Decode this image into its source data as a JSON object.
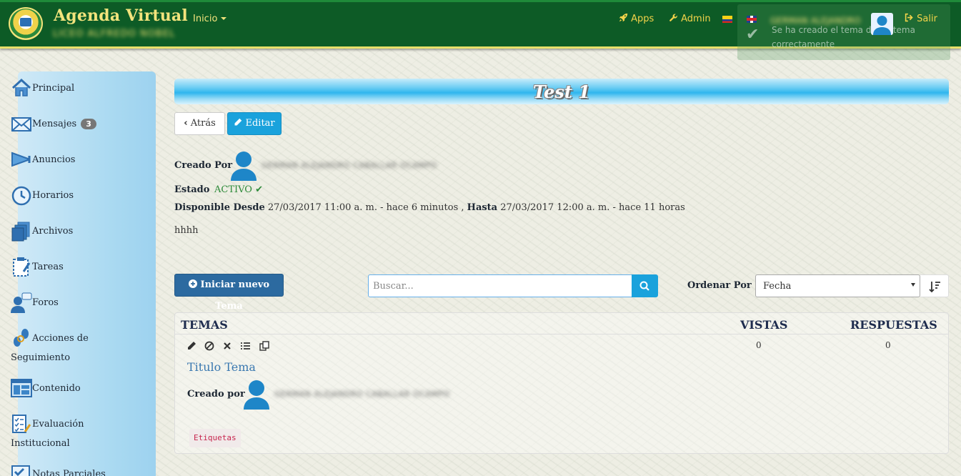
{
  "header": {
    "brand": "Agenda Virtual",
    "school": "LICEO ALFREDO NOBEL",
    "nav_inicio": "Inicio",
    "apps": "Apps",
    "admin": "Admin",
    "user_name": "GERMAN ALEJANDRO",
    "salir": "Salir"
  },
  "toast": {
    "message": "Se ha creado el tema del sistema correctamente"
  },
  "sidebar": {
    "items": [
      {
        "label": "Principal",
        "icon": "home-icon"
      },
      {
        "label": "Mensajes",
        "icon": "envelope-icon",
        "badge": "3"
      },
      {
        "label": "Anuncios",
        "icon": "megaphone-icon"
      },
      {
        "label": "Horarios",
        "icon": "clock-icon"
      },
      {
        "label": "Archivos",
        "icon": "files-icon"
      },
      {
        "label": "Tareas",
        "icon": "clipboard-icon"
      },
      {
        "label": "Foros",
        "icon": "forum-icon"
      },
      {
        "label": "Acciones de",
        "label2": "Seguimiento",
        "icon": "footsteps-icon"
      },
      {
        "label": "Contenido",
        "icon": "content-icon"
      },
      {
        "label": "Evaluación",
        "label2": "Institucional",
        "icon": "checklist-icon"
      },
      {
        "label": "Notas Parciales",
        "icon": "grades-icon"
      }
    ]
  },
  "page": {
    "title": "Test 1",
    "back": "Atrás",
    "edit": "Editar",
    "created_by_label": "Creado Por",
    "creator_name": "GERMAN ALEJANDRO CABALLAR OCAMPO",
    "estado_label": "Estado",
    "estado_value": "ACTIVO",
    "disponible_label": "Disponible Desde",
    "disponible_value": "27/03/2017 11:00 a. m. - hace 6 minutos ,",
    "hasta_label": "Hasta",
    "hasta_value": "27/03/2017 12:00 a. m. - hace 11 horas",
    "description": "hhhh"
  },
  "toolbar": {
    "new_topic": "Iniciar nuevo Tema",
    "search_placeholder": "Buscar...",
    "order_label": "Ordenar Por",
    "order_value": "Fecha"
  },
  "topics": {
    "headers": {
      "temas": "TEMAS",
      "vistas": "VISTAS",
      "respuestas": "RESPUESTAS"
    },
    "rows": [
      {
        "title": "Titulo Tema",
        "created_by_label": "Creado por",
        "creator_name": "GERMAN ALEJANDRO CABALLAR OCAMPO",
        "views": "0",
        "replies": "0",
        "tag": "Etiquetas"
      }
    ]
  },
  "colors": {
    "header_bg": "#0d5b26",
    "header_text": "#f2e37c",
    "accent_blue": "#1aa2dc",
    "new_topic_blue": "#2c6aa0",
    "status_green": "#2e8b3a"
  }
}
